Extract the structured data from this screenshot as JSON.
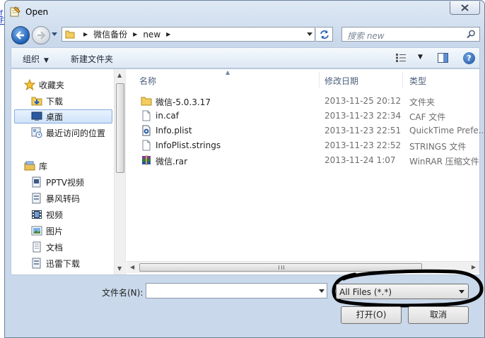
{
  "window": {
    "title": "Open"
  },
  "stray_chars": [
    "f",
    "F"
  ],
  "address": {
    "crumbs": [
      "微信备份",
      "new"
    ]
  },
  "search": {
    "placeholder": "搜索 new"
  },
  "toolbar": {
    "organize_label": "组织",
    "new_folder_label": "新建文件夹"
  },
  "nav": {
    "favorites_header": "收藏夹",
    "favorites": [
      {
        "label": "下载",
        "icon": "download-folder-icon"
      },
      {
        "label": "桌面",
        "icon": "desktop-icon",
        "selected": true
      },
      {
        "label": "最近访问的位置",
        "icon": "recent-places-icon"
      }
    ],
    "libraries_header": "库",
    "libraries": [
      {
        "label": "PPTV视频",
        "icon": "video-library-icon"
      },
      {
        "label": "暴风转码",
        "icon": "library-icon"
      },
      {
        "label": "视频",
        "icon": "video-library-icon"
      },
      {
        "label": "图片",
        "icon": "pictures-library-icon"
      },
      {
        "label": "文档",
        "icon": "documents-library-icon"
      },
      {
        "label": "迅雷下载",
        "icon": "library-icon"
      }
    ]
  },
  "columns": {
    "name": "名称",
    "modified": "修改日期",
    "type": "类型"
  },
  "files": [
    {
      "name": "微信-5.0.3.17",
      "modified": "2013-11-25 20:12",
      "type": "文件夹",
      "icon": "folder-icon"
    },
    {
      "name": "in.caf",
      "modified": "2013-11-23 22:34",
      "type": "CAF 文件",
      "icon": "file-icon"
    },
    {
      "name": "Info.plist",
      "modified": "2013-11-23 22:51",
      "type": "QuickTime Prefe...",
      "icon": "plist-file-icon"
    },
    {
      "name": "InfoPlist.strings",
      "modified": "2013-11-23 22:52",
      "type": "STRINGS 文件",
      "icon": "file-icon"
    },
    {
      "name": "微信.rar",
      "modified": "2013-11-24 1:07",
      "type": "WinRAR 压缩文件",
      "icon": "rar-archive-icon"
    }
  ],
  "footer": {
    "filename_label": "文件名(N):",
    "filename_value": "",
    "filter_value": "All Files (*.*)",
    "open_label": "打开(O)",
    "cancel_label": "取消"
  },
  "colors": {
    "selection": "#cfe3fa",
    "annotation": "#000000",
    "frame": "#c9d8ea"
  }
}
